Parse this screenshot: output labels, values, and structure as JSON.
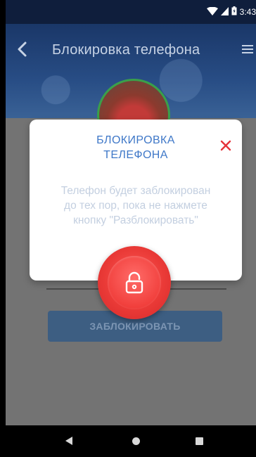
{
  "status_bar": {
    "time": "3:43"
  },
  "header": {
    "title": "Блокировка телефона"
  },
  "dialog": {
    "title": "БЛОКИРОВКА\nТЕЛЕФОНА",
    "message": "Телефон будет заблокирован\nдо тех пор, пока не нажмете\nкнопку \"Разблокировать\""
  },
  "main": {
    "lock_button_label": "ЗАБЛОКИРОВАТЬ"
  },
  "colors": {
    "accent_blue": "#3f78c8",
    "danger_red": "#ea3a37",
    "header_blue": "#1a3768",
    "avatar_ring": "#3aa04a"
  },
  "icons": {
    "back": "chevron-left-icon",
    "menu": "menu-icon",
    "close": "close-icon",
    "lock": "lock-icon"
  }
}
